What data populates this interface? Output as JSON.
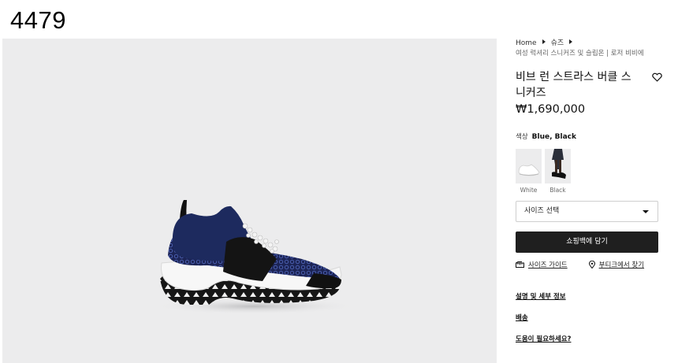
{
  "page_id": "4479",
  "breadcrumb": {
    "home": "Home",
    "category": "슈즈",
    "subcategory": "여성 럭셔리 스니커즈 및 슬립온 | 로저 비비에"
  },
  "product": {
    "title": "비브 런 스트라스 버클 스니커즈",
    "price": "₩1,690,000"
  },
  "color": {
    "label": "색상",
    "value": "Blue, Black",
    "options": [
      {
        "name": "White"
      },
      {
        "name": "Black"
      }
    ]
  },
  "size_select": {
    "placeholder": "사이즈 선택"
  },
  "add_to_bag": {
    "label": "쇼핑백에 담기"
  },
  "links": {
    "size_guide": "사이즈 가이드",
    "find_in_store": "부티크에서 찾기"
  },
  "accordion": [
    {
      "label": "설명 및 세부 정보"
    },
    {
      "label": "배송"
    },
    {
      "label": "도움이 필요하세요?"
    }
  ],
  "colors": {
    "button_bg": "#1f1f1f",
    "gallery_bg": "#ececed",
    "shoe_navy": "#1d2a5e"
  },
  "icons": {
    "wishlist": "heart-icon",
    "size_guide": "ruler-icon",
    "store": "location-pin-icon",
    "select": "caret-down-icon"
  }
}
